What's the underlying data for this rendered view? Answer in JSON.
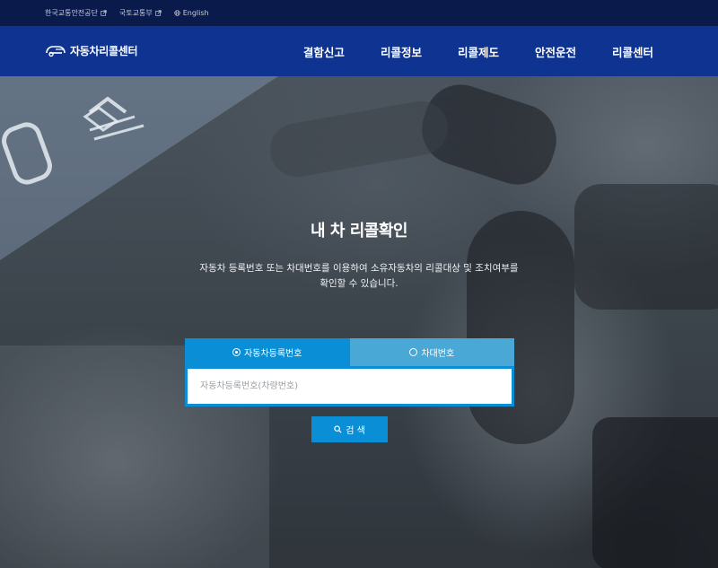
{
  "utility": {
    "links": [
      {
        "label": "한국교통안전공단",
        "icon": "external-link-icon"
      },
      {
        "label": "국토교통부",
        "icon": "external-link-icon"
      },
      {
        "label": "English",
        "icon": "globe-icon"
      }
    ]
  },
  "header": {
    "logo_text": "자동차리콜센터",
    "logo_icon": "car-logo-icon",
    "menu": [
      "결함신고",
      "리콜정보",
      "리콜제도",
      "안전운전",
      "리콜센터"
    ]
  },
  "hero": {
    "title": "내 차 리콜확인",
    "description_line1": "자동차 등록번호 또는 차대번호를 이용하여 소유자동차의 리콜대상 및 조치여부를",
    "description_line2": "확인할 수 있습니다."
  },
  "search": {
    "tabs": [
      {
        "label": "자동차등록번호",
        "selected": true
      },
      {
        "label": "차대번호",
        "selected": false
      }
    ],
    "placeholder": "자동차등록번호(차량번호)",
    "value": "",
    "button_label": "검 색",
    "button_icon": "search-icon"
  },
  "colors": {
    "util_bar": "#0a1a4a",
    "nav_bar": "#0e3391",
    "accent": "#0a8fd6",
    "tab_inactive": "#4aa8d6"
  }
}
